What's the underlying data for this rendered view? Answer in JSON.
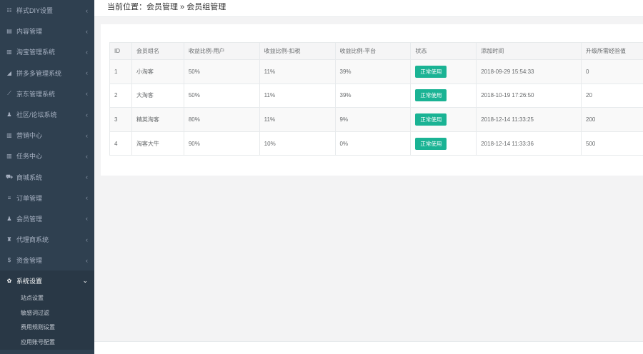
{
  "sidebar": {
    "items": [
      {
        "icon": "list-icon",
        "glyph": "☷",
        "label": "样式DIY设置"
      },
      {
        "icon": "file-icon",
        "glyph": "▤",
        "label": "内容管理"
      },
      {
        "icon": "bar-chart-icon",
        "glyph": "▥",
        "label": "淘宝管理系统"
      },
      {
        "icon": "area-chart-icon",
        "glyph": "◢",
        "label": "拼多多管理系统"
      },
      {
        "icon": "line-chart-icon",
        "glyph": "⟋",
        "label": "京东管理系统"
      },
      {
        "icon": "users-icon",
        "glyph": "♟",
        "label": "社区/论坛系统"
      },
      {
        "icon": "bar-chart-icon",
        "glyph": "▥",
        "label": "营销中心"
      },
      {
        "icon": "bar-chart-icon",
        "glyph": "▥",
        "label": "任务中心"
      },
      {
        "icon": "cart-icon",
        "glyph": "⛟",
        "label": "商城系统"
      },
      {
        "icon": "bars-icon",
        "glyph": "≡",
        "label": "订单管理"
      },
      {
        "icon": "user-icon",
        "glyph": "♟",
        "label": "会员管理"
      },
      {
        "icon": "agent-icon",
        "glyph": "♜",
        "label": "代理商系统"
      },
      {
        "icon": "dollar-icon",
        "glyph": "$",
        "label": "资金管理"
      }
    ],
    "active": {
      "icon": "gear-icon",
      "glyph": "✿",
      "label": "系统设置"
    },
    "subitems": [
      "站点设置",
      "敏感词过滤",
      "费用规则设置",
      "应用账号配置"
    ]
  },
  "breadcrumb": {
    "prefix": "当前位置：",
    "path": "会员管理 » 会员组管理"
  },
  "table": {
    "headers": [
      "ID",
      "会员组名",
      "收益比例-用户",
      "收益比例-扣税",
      "收益比例-平台",
      "状态",
      "添加时间",
      "升级所需经验值"
    ],
    "rows": [
      [
        "1",
        "小淘客",
        "50%",
        "11%",
        "39%",
        "正常使用",
        "2018-09-29 15:54:33",
        "0"
      ],
      [
        "2",
        "大淘客",
        "50%",
        "11%",
        "39%",
        "正常使用",
        "2018-10-19 17:26:50",
        "20"
      ],
      [
        "3",
        "精英淘客",
        "80%",
        "11%",
        "9%",
        "正常使用",
        "2018-12-14 11:33:25",
        "200"
      ],
      [
        "4",
        "淘客大牛",
        "90%",
        "10%",
        "0%",
        "正常使用",
        "2018-12-14 11:33:36",
        "500"
      ]
    ]
  },
  "colors": {
    "sidebar": "#2f4050",
    "badge": "#1ab394"
  }
}
